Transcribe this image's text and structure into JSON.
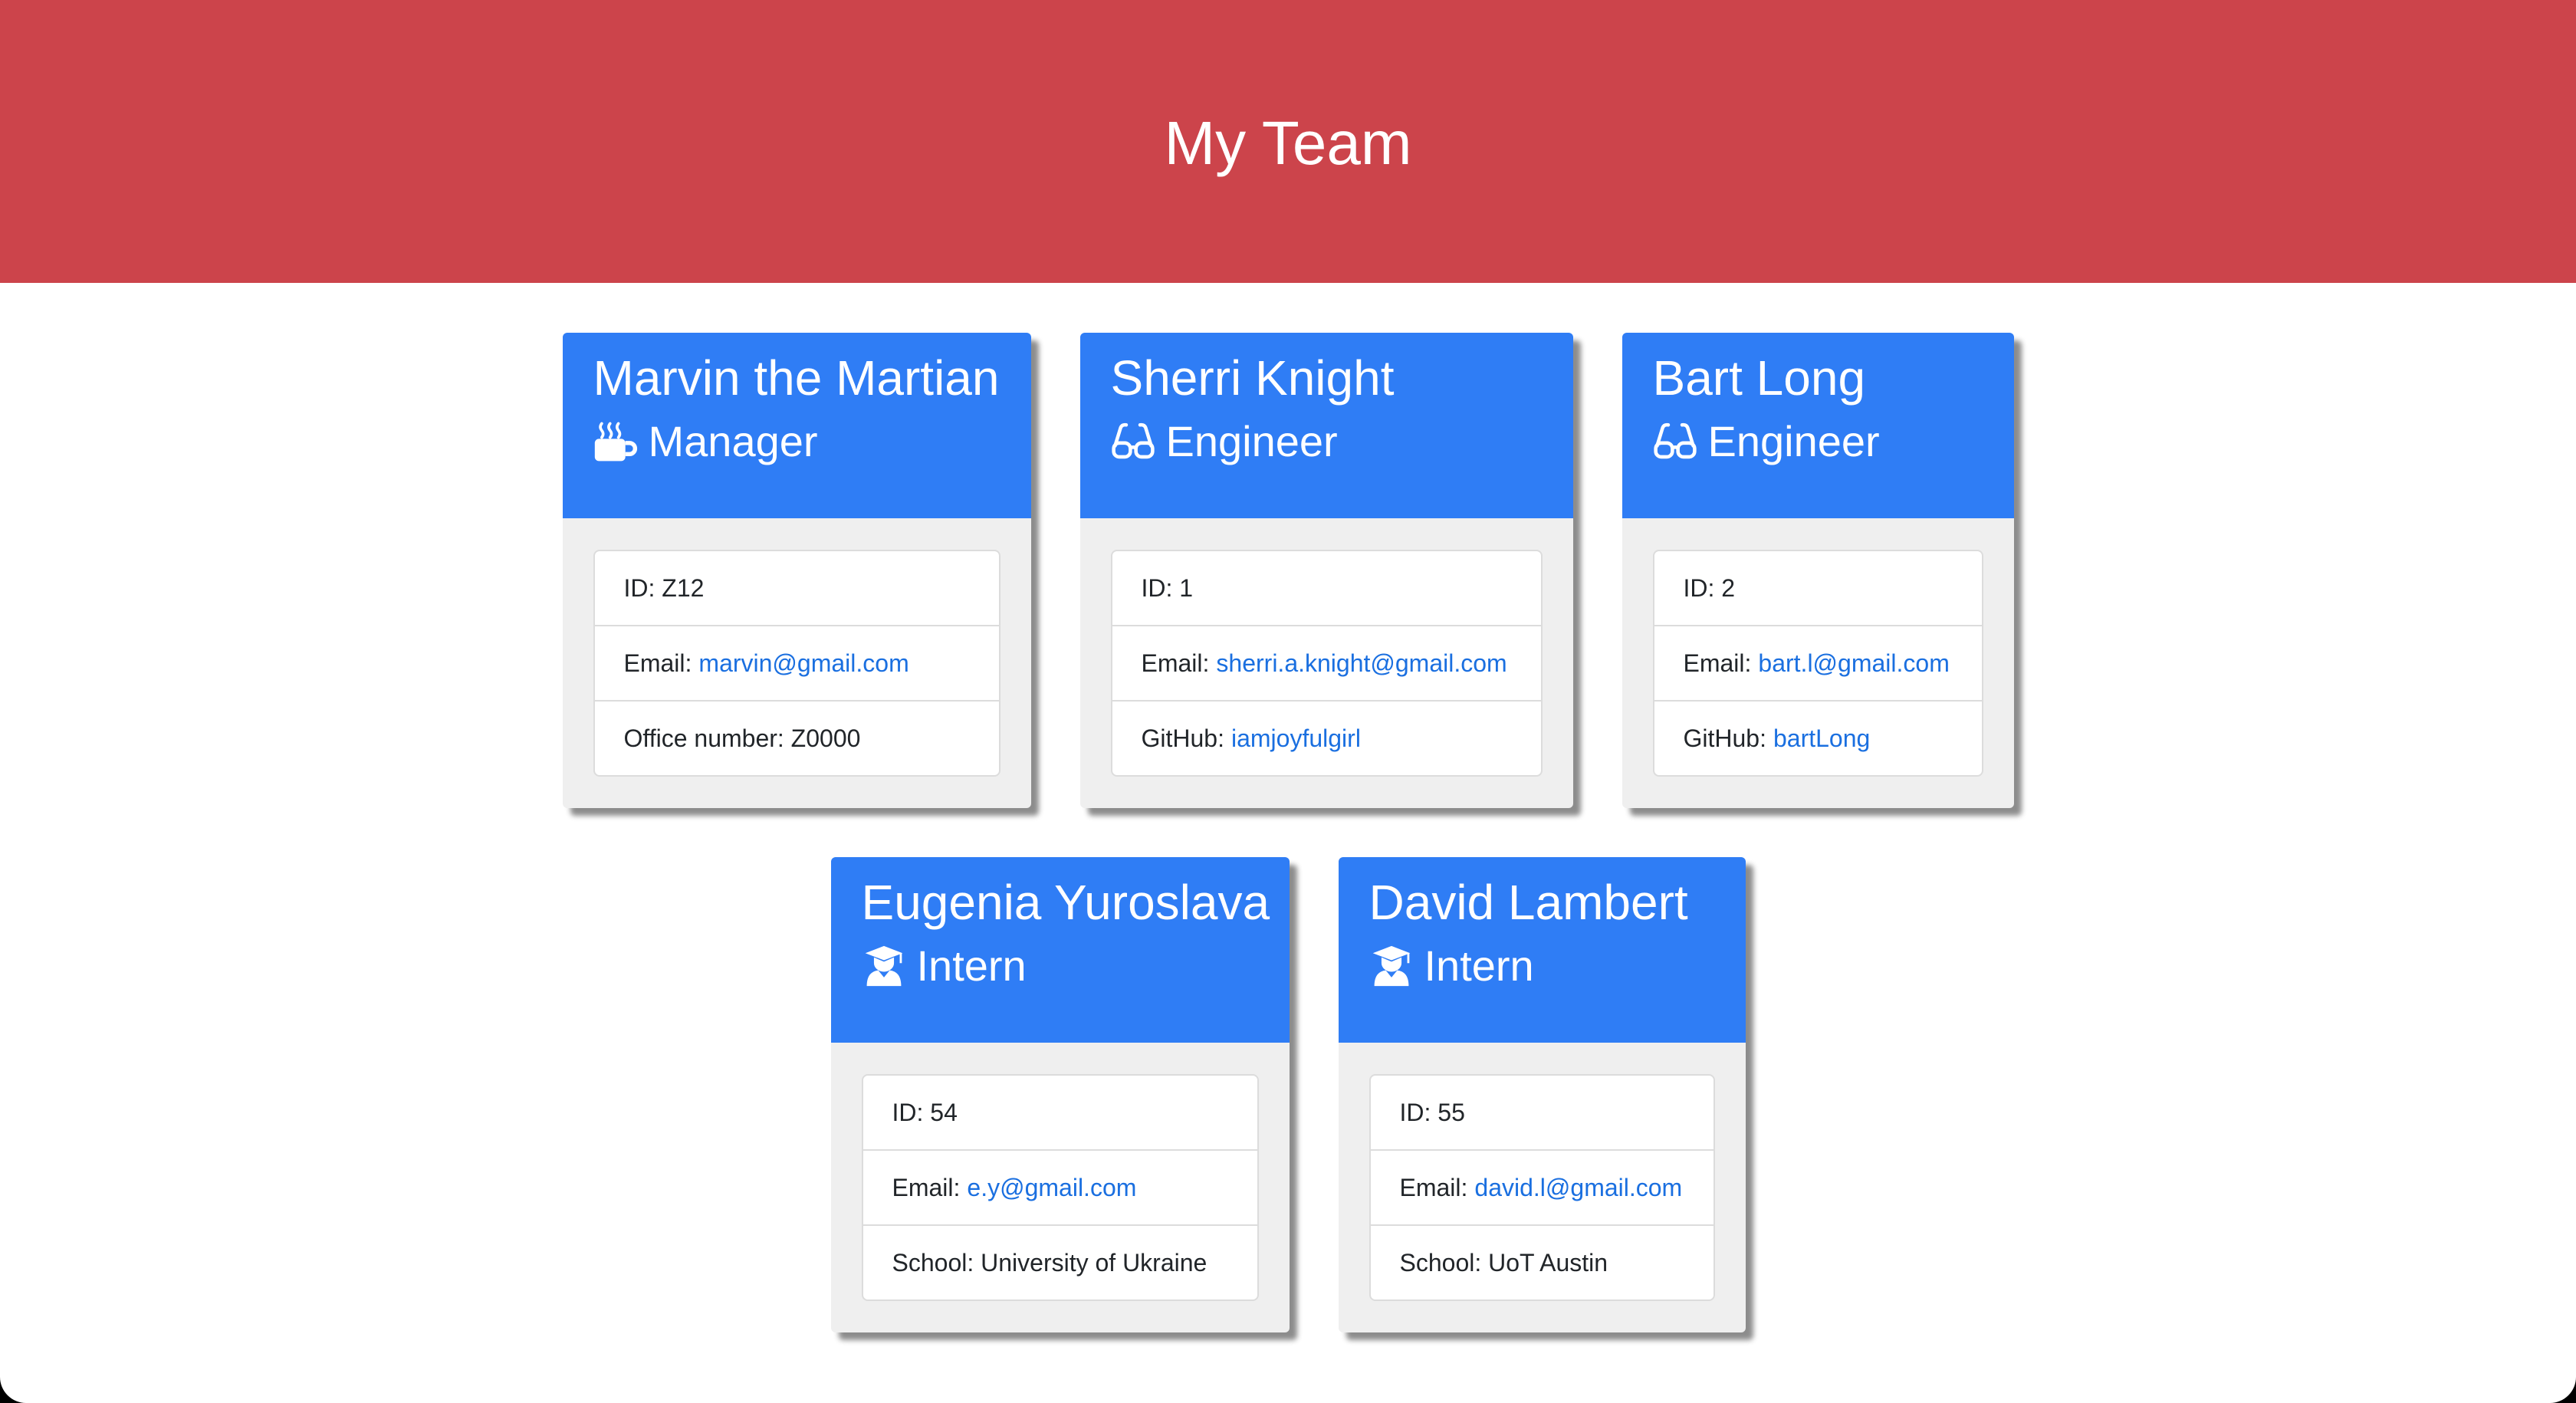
{
  "header": {
    "title": "My Team"
  },
  "colors": {
    "header_bg": "#cc444b",
    "card_header_bg": "#2f7df5",
    "link": "#1a6fe0"
  },
  "team": [
    {
      "name": "Marvin the Martian",
      "role": "Manager",
      "role_icon": "coffee-mug-icon",
      "id_label": "ID: Z12",
      "email_label": "Email:",
      "email": "marvin@gmail.com",
      "extra_label": "Office number: Z0000",
      "extra_link": ""
    },
    {
      "name": "Sherri Knight",
      "role": "Engineer",
      "role_icon": "glasses-icon",
      "id_label": "ID: 1",
      "email_label": "Email:",
      "email": "sherri.a.knight@gmail.com",
      "extra_label": "GitHub:",
      "extra_link": "iamjoyfulgirl"
    },
    {
      "name": "Bart Long",
      "role": "Engineer",
      "role_icon": "glasses-icon",
      "id_label": "ID: 2",
      "email_label": "Email:",
      "email": "bart.l@gmail.com",
      "extra_label": "GitHub:",
      "extra_link": "bartLong"
    },
    {
      "name": "Eugenia Yuroslava",
      "role": "Intern",
      "role_icon": "graduate-icon",
      "id_label": "ID: 54",
      "email_label": "Email:",
      "email": "e.y@gmail.com",
      "extra_label": "School: University of Ukraine",
      "extra_link": ""
    },
    {
      "name": "David Lambert",
      "role": "Intern",
      "role_icon": "graduate-icon",
      "id_label": "ID: 55",
      "email_label": "Email:",
      "email": "david.l@gmail.com",
      "extra_label": "School: UoT Austin",
      "extra_link": ""
    }
  ]
}
